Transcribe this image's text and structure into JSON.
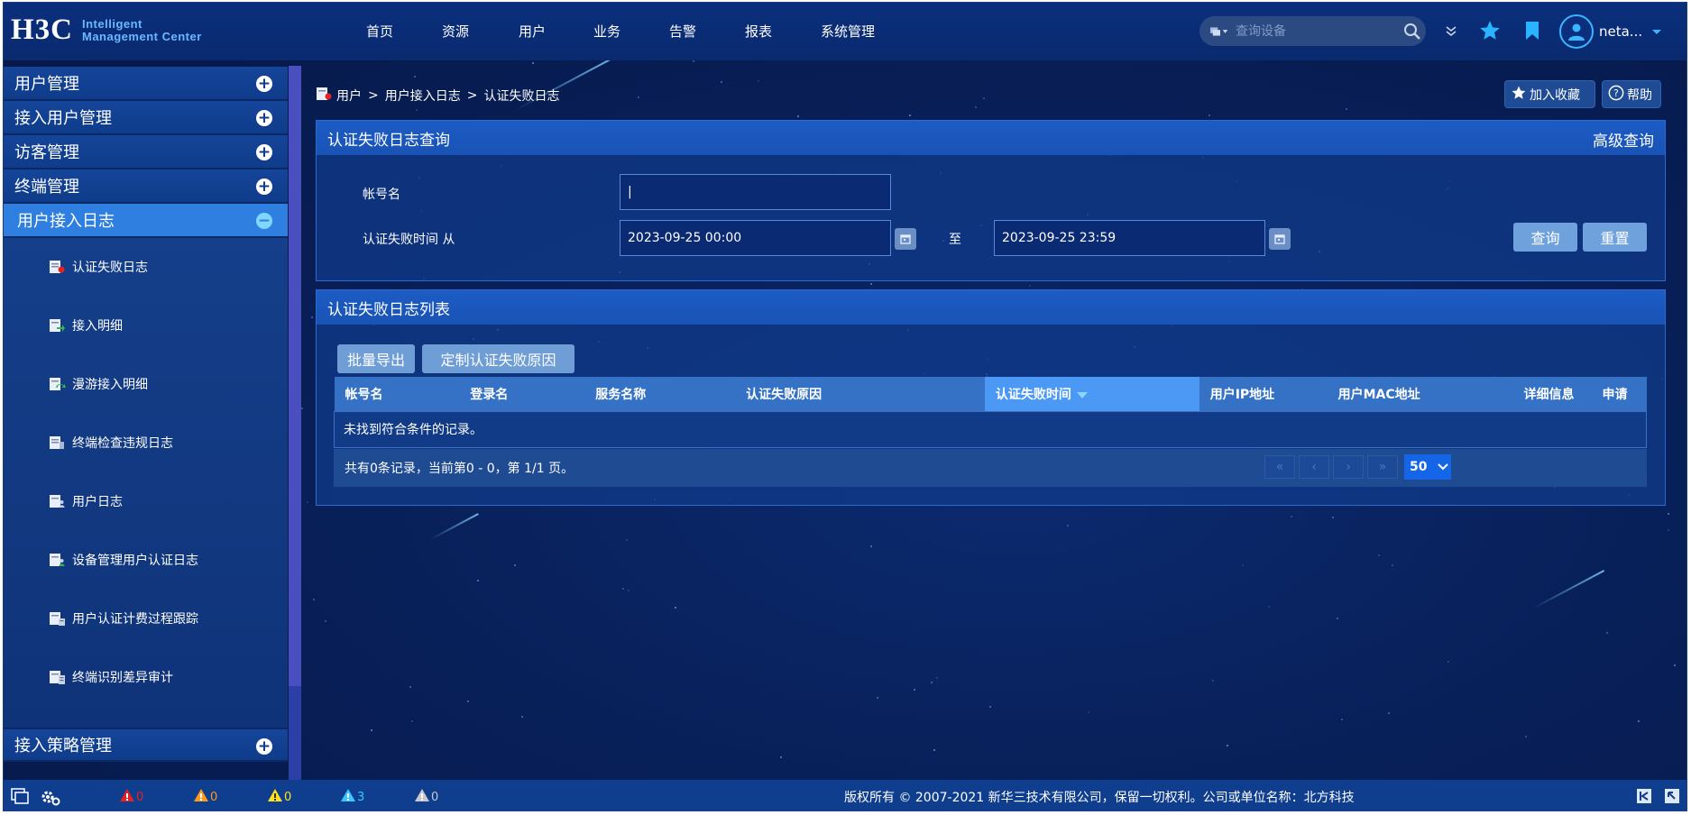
{
  "header": {
    "logo_mark": "H3C",
    "logo_line1": "Intelligent",
    "logo_line2": "Management Center",
    "nav": [
      "首页",
      "资源",
      "用户",
      "业务",
      "告警",
      "报表",
      "系统管理"
    ],
    "search_placeholder": "查询设备",
    "user_name": "neta..."
  },
  "sidebar": {
    "sections_top": [
      "用户管理",
      "接入用户管理",
      "访客管理",
      "终端管理"
    ],
    "active_section": "用户接入日志",
    "sub_items": [
      "认证失败日志",
      "接入明细",
      "漫游接入明细",
      "终端检查违规日志",
      "用户日志",
      "设备管理用户认证日志",
      "用户认证计费过程跟踪",
      "终端识别差异审计"
    ],
    "sections_bottom": [
      "接入策略管理"
    ]
  },
  "breadcrumb": [
    "用户",
    "用户接入日志",
    "认证失败日志"
  ],
  "breadcrumb_sep": ">",
  "toolbar": {
    "favorite": "加入收藏",
    "help": "帮助"
  },
  "query_panel": {
    "title": "认证失败日志查询",
    "advanced": "高级查询",
    "account_label": "帐号名",
    "account_value": "|",
    "time_label": "认证失败时间 从",
    "time_from": "2023-09-25 00:00",
    "to_label": "至",
    "time_to": "2023-09-25 23:59",
    "query_btn": "查询",
    "reset_btn": "重置"
  },
  "list_panel": {
    "title": "认证失败日志列表",
    "btn_export": "批量导出",
    "btn_custom": "定制认证失败原因",
    "columns": [
      "帐号名",
      "登录名",
      "服务名称",
      "认证失败原因",
      "认证失败时间",
      "用户IP地址",
      "用户MAC地址",
      "详细信息",
      "申请"
    ],
    "empty_text": "未找到符合条件的记录。",
    "pager_text": "共有0条记录，当前第0 - 0，第 1/1 页。",
    "page_size": "50"
  },
  "status": {
    "alarms": [
      {
        "count": "0",
        "color": "#e52222"
      },
      {
        "count": "0",
        "color": "#ff9a1a"
      },
      {
        "count": "0",
        "color": "#ffe21a"
      },
      {
        "count": "3",
        "color": "#38c8ff"
      },
      {
        "count": "0",
        "color": "#c9c9c9"
      }
    ],
    "copyright": "版权所有 © 2007-2021 新华三技术有限公司，保留一切权利。公司或单位名称：北方科技"
  }
}
